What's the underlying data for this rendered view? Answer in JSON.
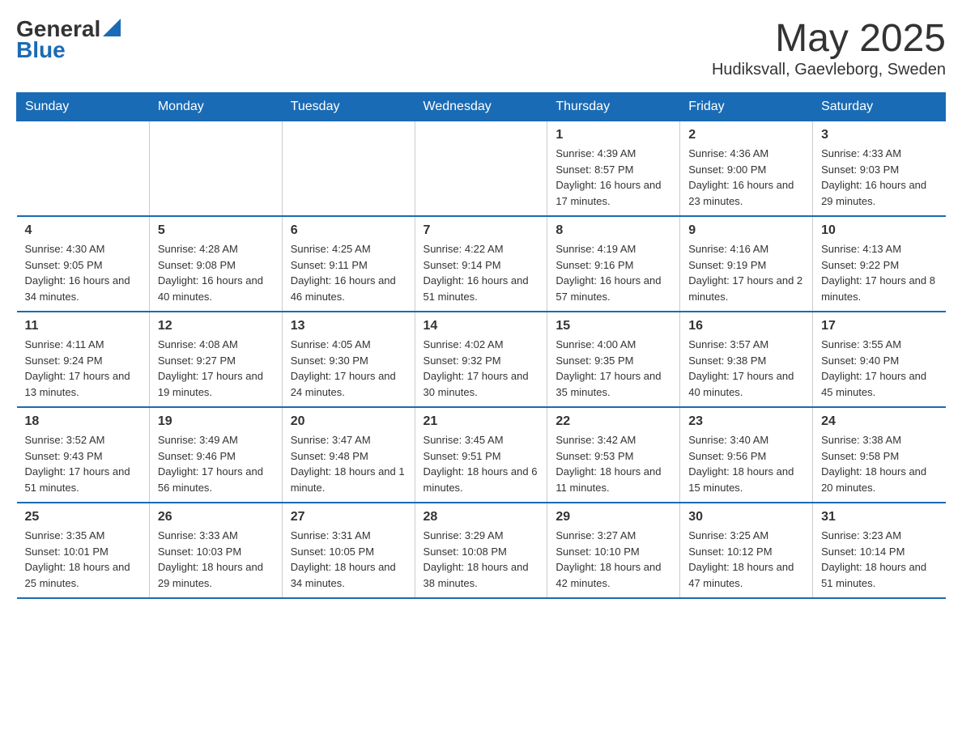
{
  "logo": {
    "general": "General",
    "blue": "Blue"
  },
  "title": "May 2025",
  "location": "Hudiksvall, Gaevleborg, Sweden",
  "headers": [
    "Sunday",
    "Monday",
    "Tuesday",
    "Wednesday",
    "Thursday",
    "Friday",
    "Saturday"
  ],
  "weeks": [
    [
      {
        "day": "",
        "info": ""
      },
      {
        "day": "",
        "info": ""
      },
      {
        "day": "",
        "info": ""
      },
      {
        "day": "",
        "info": ""
      },
      {
        "day": "1",
        "info": "Sunrise: 4:39 AM\nSunset: 8:57 PM\nDaylight: 16 hours and 17 minutes."
      },
      {
        "day": "2",
        "info": "Sunrise: 4:36 AM\nSunset: 9:00 PM\nDaylight: 16 hours and 23 minutes."
      },
      {
        "day": "3",
        "info": "Sunrise: 4:33 AM\nSunset: 9:03 PM\nDaylight: 16 hours and 29 minutes."
      }
    ],
    [
      {
        "day": "4",
        "info": "Sunrise: 4:30 AM\nSunset: 9:05 PM\nDaylight: 16 hours and 34 minutes."
      },
      {
        "day": "5",
        "info": "Sunrise: 4:28 AM\nSunset: 9:08 PM\nDaylight: 16 hours and 40 minutes."
      },
      {
        "day": "6",
        "info": "Sunrise: 4:25 AM\nSunset: 9:11 PM\nDaylight: 16 hours and 46 minutes."
      },
      {
        "day": "7",
        "info": "Sunrise: 4:22 AM\nSunset: 9:14 PM\nDaylight: 16 hours and 51 minutes."
      },
      {
        "day": "8",
        "info": "Sunrise: 4:19 AM\nSunset: 9:16 PM\nDaylight: 16 hours and 57 minutes."
      },
      {
        "day": "9",
        "info": "Sunrise: 4:16 AM\nSunset: 9:19 PM\nDaylight: 17 hours and 2 minutes."
      },
      {
        "day": "10",
        "info": "Sunrise: 4:13 AM\nSunset: 9:22 PM\nDaylight: 17 hours and 8 minutes."
      }
    ],
    [
      {
        "day": "11",
        "info": "Sunrise: 4:11 AM\nSunset: 9:24 PM\nDaylight: 17 hours and 13 minutes."
      },
      {
        "day": "12",
        "info": "Sunrise: 4:08 AM\nSunset: 9:27 PM\nDaylight: 17 hours and 19 minutes."
      },
      {
        "day": "13",
        "info": "Sunrise: 4:05 AM\nSunset: 9:30 PM\nDaylight: 17 hours and 24 minutes."
      },
      {
        "day": "14",
        "info": "Sunrise: 4:02 AM\nSunset: 9:32 PM\nDaylight: 17 hours and 30 minutes."
      },
      {
        "day": "15",
        "info": "Sunrise: 4:00 AM\nSunset: 9:35 PM\nDaylight: 17 hours and 35 minutes."
      },
      {
        "day": "16",
        "info": "Sunrise: 3:57 AM\nSunset: 9:38 PM\nDaylight: 17 hours and 40 minutes."
      },
      {
        "day": "17",
        "info": "Sunrise: 3:55 AM\nSunset: 9:40 PM\nDaylight: 17 hours and 45 minutes."
      }
    ],
    [
      {
        "day": "18",
        "info": "Sunrise: 3:52 AM\nSunset: 9:43 PM\nDaylight: 17 hours and 51 minutes."
      },
      {
        "day": "19",
        "info": "Sunrise: 3:49 AM\nSunset: 9:46 PM\nDaylight: 17 hours and 56 minutes."
      },
      {
        "day": "20",
        "info": "Sunrise: 3:47 AM\nSunset: 9:48 PM\nDaylight: 18 hours and 1 minute."
      },
      {
        "day": "21",
        "info": "Sunrise: 3:45 AM\nSunset: 9:51 PM\nDaylight: 18 hours and 6 minutes."
      },
      {
        "day": "22",
        "info": "Sunrise: 3:42 AM\nSunset: 9:53 PM\nDaylight: 18 hours and 11 minutes."
      },
      {
        "day": "23",
        "info": "Sunrise: 3:40 AM\nSunset: 9:56 PM\nDaylight: 18 hours and 15 minutes."
      },
      {
        "day": "24",
        "info": "Sunrise: 3:38 AM\nSunset: 9:58 PM\nDaylight: 18 hours and 20 minutes."
      }
    ],
    [
      {
        "day": "25",
        "info": "Sunrise: 3:35 AM\nSunset: 10:01 PM\nDaylight: 18 hours and 25 minutes."
      },
      {
        "day": "26",
        "info": "Sunrise: 3:33 AM\nSunset: 10:03 PM\nDaylight: 18 hours and 29 minutes."
      },
      {
        "day": "27",
        "info": "Sunrise: 3:31 AM\nSunset: 10:05 PM\nDaylight: 18 hours and 34 minutes."
      },
      {
        "day": "28",
        "info": "Sunrise: 3:29 AM\nSunset: 10:08 PM\nDaylight: 18 hours and 38 minutes."
      },
      {
        "day": "29",
        "info": "Sunrise: 3:27 AM\nSunset: 10:10 PM\nDaylight: 18 hours and 42 minutes."
      },
      {
        "day": "30",
        "info": "Sunrise: 3:25 AM\nSunset: 10:12 PM\nDaylight: 18 hours and 47 minutes."
      },
      {
        "day": "31",
        "info": "Sunrise: 3:23 AM\nSunset: 10:14 PM\nDaylight: 18 hours and 51 minutes."
      }
    ]
  ]
}
